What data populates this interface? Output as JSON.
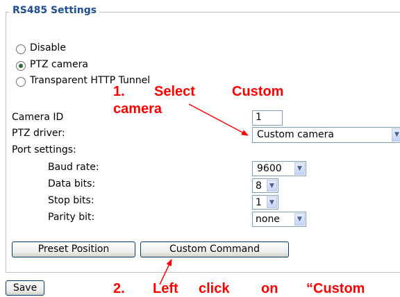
{
  "section_title": "RS485 Settings",
  "mode_options": [
    {
      "label": "Disable",
      "checked": false
    },
    {
      "label": "PTZ camera",
      "checked": true
    },
    {
      "label": "Transparent HTTP Tunnel",
      "checked": false
    }
  ],
  "camera_id": {
    "label": "Camera ID",
    "value": "1"
  },
  "ptz_driver": {
    "label": "PTZ driver:",
    "value": "Custom camera"
  },
  "port_settings": {
    "label": "Port settings:",
    "baud_rate": {
      "label": "Baud rate:",
      "value": "9600"
    },
    "data_bits": {
      "label": "Data bits:",
      "value": "8"
    },
    "stop_bits": {
      "label": "Stop bits:",
      "value": "1"
    },
    "parity_bit": {
      "label": "Parity bit:",
      "value": "none"
    }
  },
  "buttons": {
    "preset_position": "Preset Position",
    "custom_command": "Custom Command",
    "save": "Save"
  },
  "annotations": {
    "step1": {
      "num": "1.",
      "select": "Select",
      "custom": "Custom",
      "camera": "camera"
    },
    "step2": {
      "num": "2.",
      "left": "Left",
      "click": "click",
      "on": "on",
      "custom": "“Custom"
    }
  },
  "colors": {
    "accent": "#1f4e98",
    "annotation": "#ff0000",
    "input_border": "#7f9db9"
  }
}
